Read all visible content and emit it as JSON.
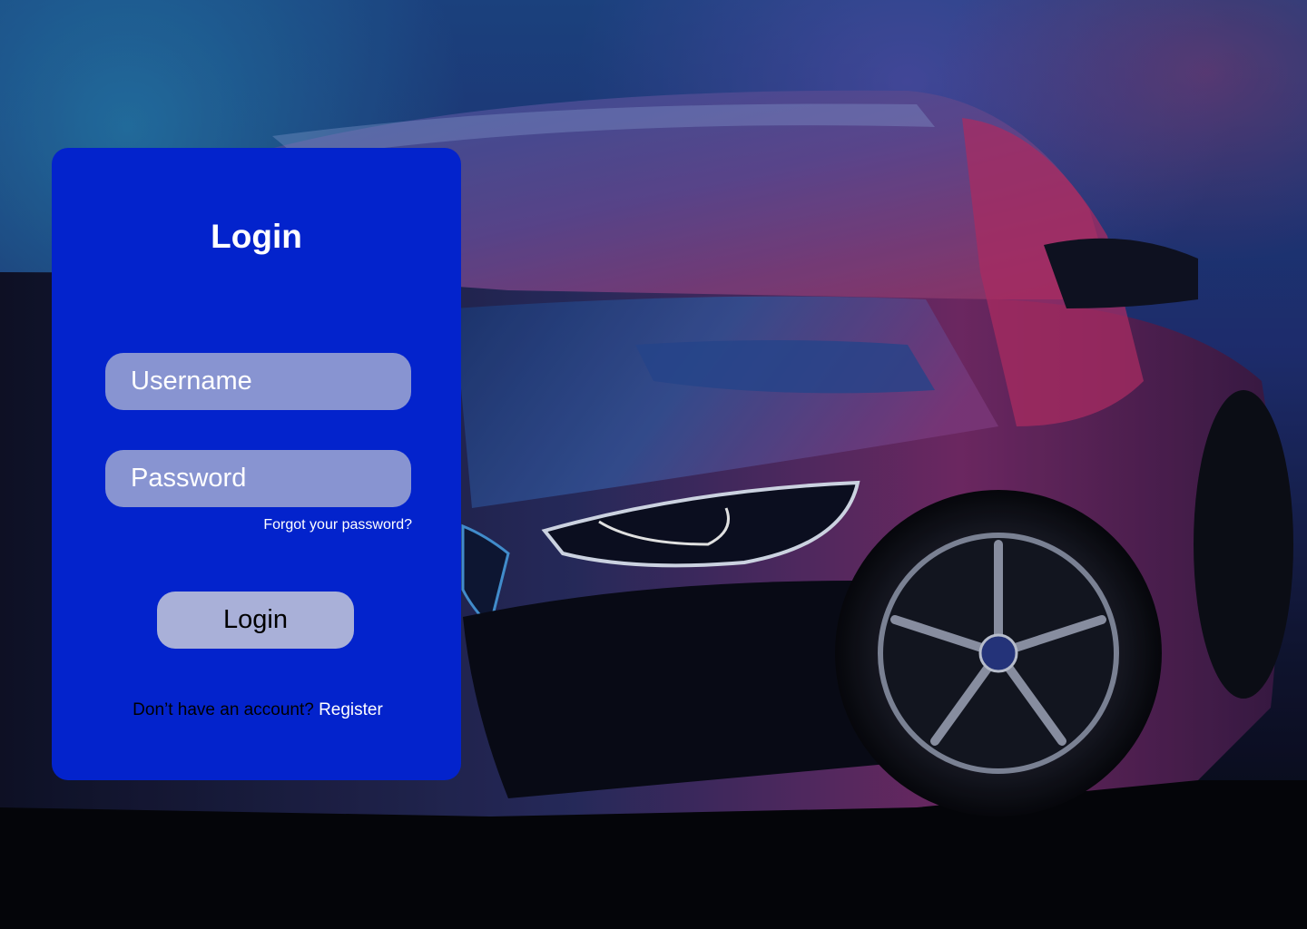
{
  "login": {
    "title": "Login",
    "username_placeholder": "Username",
    "password_placeholder": "Password",
    "forgot_password": "Forgot your password?",
    "submit_label": "Login",
    "no_account_prompt": "Don’t have an account?",
    "register_label": "Register"
  },
  "theme": {
    "card_color": "#0323cc",
    "field_color": "#8894d1",
    "button_color": "#a9b0d8"
  }
}
